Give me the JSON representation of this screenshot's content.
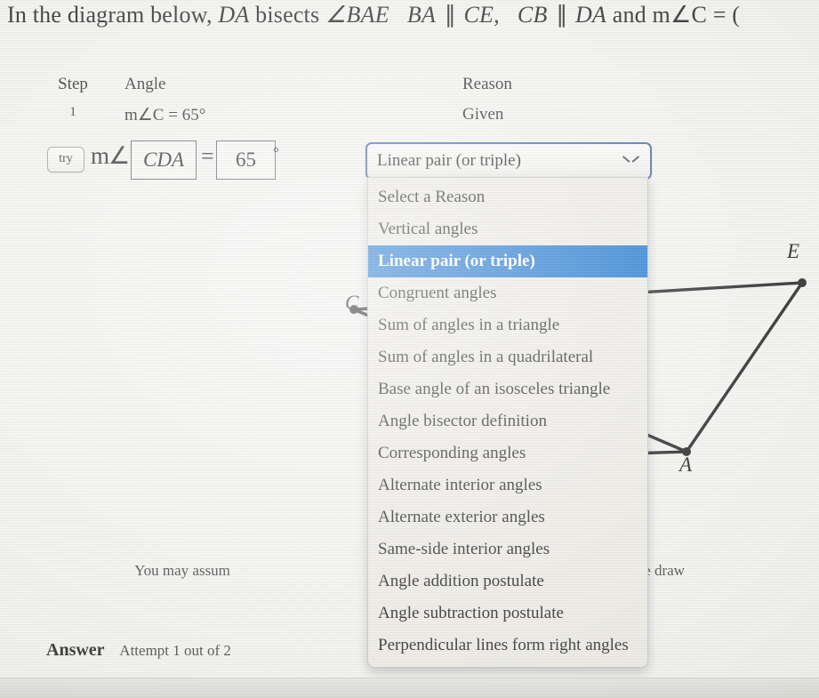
{
  "prompt": {
    "lead": "In the diagram below,",
    "seg_da": "DA",
    "bisects": "bisects",
    "angle_bae": "∠BAE",
    "seg_ba": "BA",
    "parallel1": "∥",
    "seg_ce": "CE,",
    "seg_cb": "CB",
    "parallel2": "∥",
    "seg_da2": "DA",
    "and": "and",
    "m_angle_c": "m∠C =",
    "trailing": "("
  },
  "table": {
    "headers": {
      "step": "Step",
      "angle": "Angle",
      "reason": "Reason"
    },
    "rows": [
      {
        "step": "1",
        "angle": "m∠C = 65°",
        "reason": "Given"
      }
    ]
  },
  "answer_row": {
    "try_label": "try",
    "m_angle_prefix": "m∠",
    "angle_name": "CDA",
    "equals": "=",
    "angle_value": "65",
    "degree": "°"
  },
  "reason_select": {
    "selected": "Linear pair (or triple)",
    "chevron": "chevron-down-icon",
    "options": [
      "Select a Reason",
      "Vertical angles",
      "Linear pair (or triple)",
      "Congruent angles",
      "Sum of angles in a triangle",
      "Sum of angles in a quadrilateral",
      "Base angle of an isosceles triangle",
      "Angle bisector definition",
      "Corresponding angles",
      "Alternate interior angles",
      "Alternate exterior angles",
      "Same-side interior angles",
      "Angle addition postulate",
      "Angle subtraction postulate",
      "Perpendicular lines form right angles"
    ],
    "selected_index": 2,
    "highlight_color": "#0f6ecd",
    "border_color": "#3e5f96"
  },
  "figure": {
    "labels": {
      "c": "C",
      "e": "E",
      "a": "A"
    }
  },
  "assume_note": {
    "left_part": "You may assum",
    "right_part": "e figure is not otherwise draw"
  },
  "footer": {
    "answer_label": "Answer",
    "attempt_text": "Attempt 1 out of 2"
  }
}
